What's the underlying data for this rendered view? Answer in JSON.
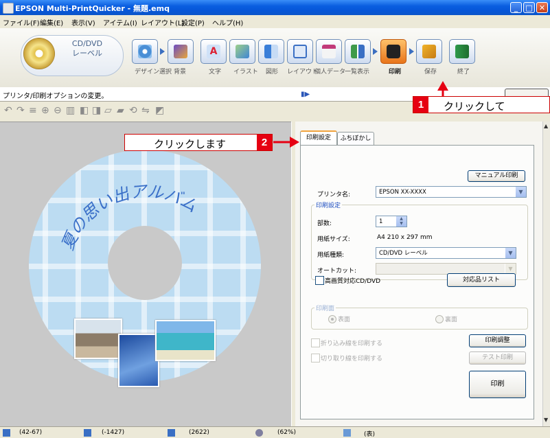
{
  "window": {
    "title": "EPSON Multi-PrintQuicker - 無題.emq"
  },
  "menu": [
    "ファイル(F)",
    "編集(E)",
    "表示(V)",
    "アイテム(I)",
    "レイアウト(L)",
    "設定(P)",
    "ヘルプ(H)"
  ],
  "toolbar": {
    "logo_label_line1": "CD/DVD",
    "logo_label_line2": "レーベル",
    "items": [
      {
        "label": "デザイン選択",
        "icon": "design-select-icon"
      },
      {
        "label": "背景",
        "icon": "background-icon"
      },
      {
        "label": "文字",
        "icon": "text-icon"
      },
      {
        "label": "イラスト",
        "icon": "illustration-icon"
      },
      {
        "label": "図形",
        "icon": "shape-icon"
      },
      {
        "label": "レイアウト",
        "icon": "layout-icon"
      },
      {
        "label": "個人データ",
        "icon": "personal-data-icon"
      },
      {
        "label": "一覧表示",
        "icon": "list-view-icon"
      },
      {
        "label": "印刷",
        "icon": "print-icon"
      },
      {
        "label": "保存",
        "icon": "save-icon"
      },
      {
        "label": "終了",
        "icon": "exit-icon"
      }
    ]
  },
  "hint": {
    "text": "プリンタ/印刷オプションの変更。"
  },
  "disc": {
    "arc_text": "夏の思い出アルバム"
  },
  "tabs": [
    {
      "label": "印刷設定",
      "selected": true
    },
    {
      "label": "ふちぼかし",
      "selected": false
    }
  ],
  "print_settings": {
    "manual_print_button": "マニュアル印刷",
    "printer_label": "プリンタ名:",
    "printer_value": "EPSON XX-XXXX",
    "group_print_settings": "印刷設定",
    "copies_label": "部数:",
    "copies_value": "1",
    "paper_size_label": "用紙サイズ:",
    "paper_size_value": "A4 210 x 297 mm",
    "paper_type_label": "用紙種類:",
    "paper_type_value": "CD/DVD レーベル",
    "autocut_label": "オートカット:",
    "autocut_value": "",
    "hq_checkbox_label": "高画質対応CD/DVD",
    "compat_list_button": "対応品リスト",
    "group_print_side": "印刷面",
    "side_front": "表面",
    "side_back": "裏面",
    "fold_line_label": "折り込み線を印刷する",
    "cut_line_label": "切り取り線を印刷する",
    "print_adjust_button": "印刷調整",
    "test_print_button": "テスト印刷",
    "print_button": "印刷"
  },
  "status": {
    "coords": "(42-67)",
    "size": "(-1427)",
    "pos": "(2622)",
    "zoom": "(62%)",
    "side": "(表)"
  },
  "callouts": {
    "step1_num": "1",
    "step1_text": "クリックして",
    "step2_num": "2",
    "step2_text": "クリックします"
  },
  "colors": {
    "accent": "#e60012",
    "titlebar": "#0a5ee0",
    "active_tool": "#e8741a"
  }
}
